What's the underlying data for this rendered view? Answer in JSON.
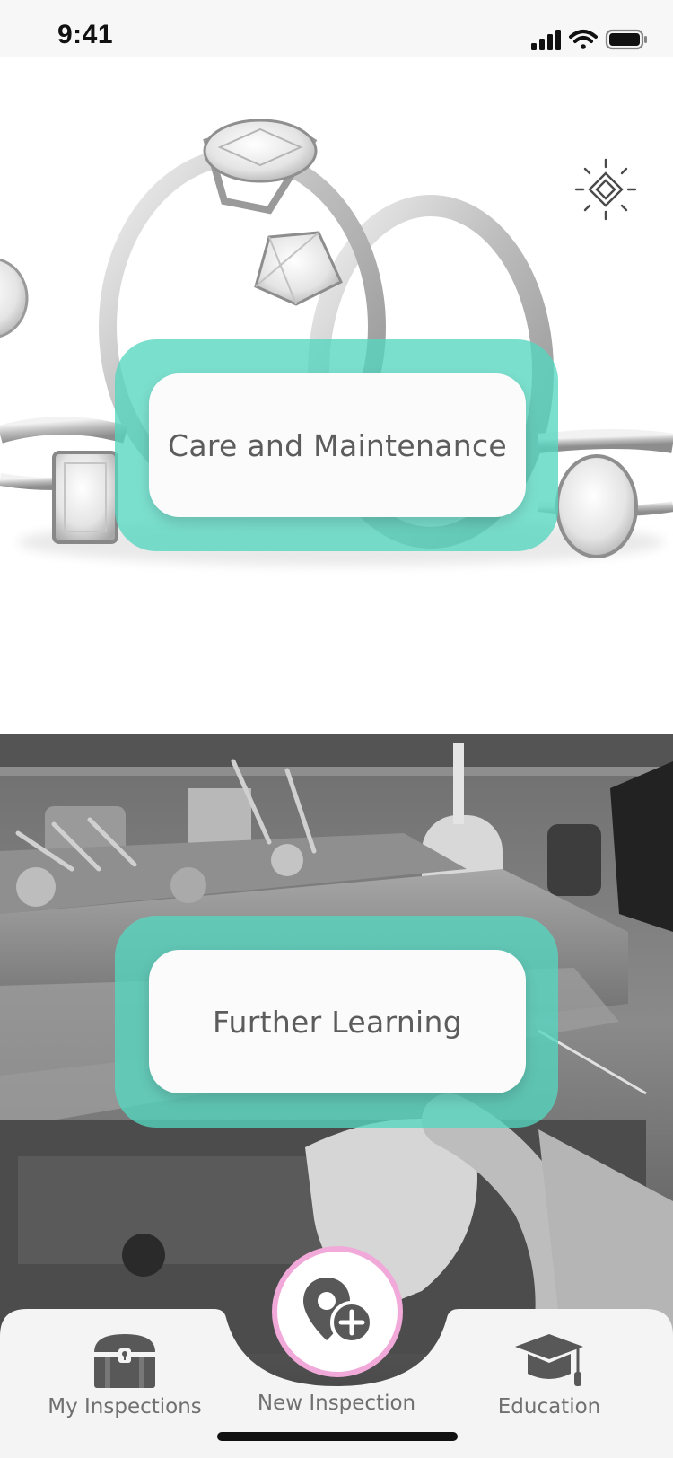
{
  "status_bar": {
    "time": "9:41"
  },
  "menu": {
    "care": {
      "label": "Care and Maintenance"
    },
    "learning": {
      "label": "Further Learning"
    }
  },
  "tabs": [
    {
      "label": "My Inspections",
      "icon": "treasure-chest-icon"
    },
    {
      "label": "New Inspection",
      "icon": "map-pin-plus-icon"
    },
    {
      "label": "Education",
      "icon": "graduation-cap-icon"
    }
  ],
  "colors": {
    "accent_teal": "#56d6c0",
    "fab_ring": "#f1a9d9",
    "icon_gray": "#585858"
  }
}
